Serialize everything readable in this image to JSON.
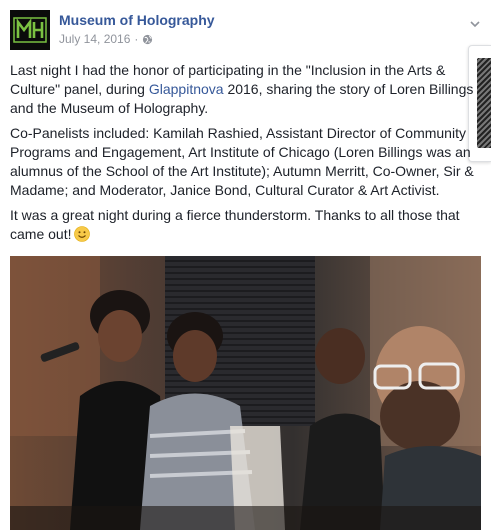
{
  "post": {
    "page_name": "Museum of Holography",
    "date": "July 14, 2016",
    "separator": "·",
    "avatar_logo_text": "MH",
    "paragraphs": {
      "p1_before": "Last night I had the honor of participating in the \"Inclusion in the Arts & Culture\" panel, during ",
      "p1_link": "Glappitnova",
      "p1_after": " 2016, sharing the story of Loren Billings and the Museum of Holography.",
      "p2": "Co-Panelists included: Kamilah Rashied, Assistant Director of Community Programs and Engagement, Art Institute of Chicago (Loren Billings was an alumnus of the School of the Art Institute); Autumn Merritt, Co-Owner, Sir & Madame; and Moderator, Janice Bond, Cultural Curator & Art Activist.",
      "p3": "It was a great night during a fierce thunderstorm. Thanks to all those that came out!"
    },
    "icons": {
      "globe": "globe-icon",
      "chevron": "chevron-down-icon",
      "emoji": "smile-emoji-icon"
    },
    "colors": {
      "link": "#365899",
      "meta": "#90949c",
      "text": "#1d2129"
    }
  }
}
